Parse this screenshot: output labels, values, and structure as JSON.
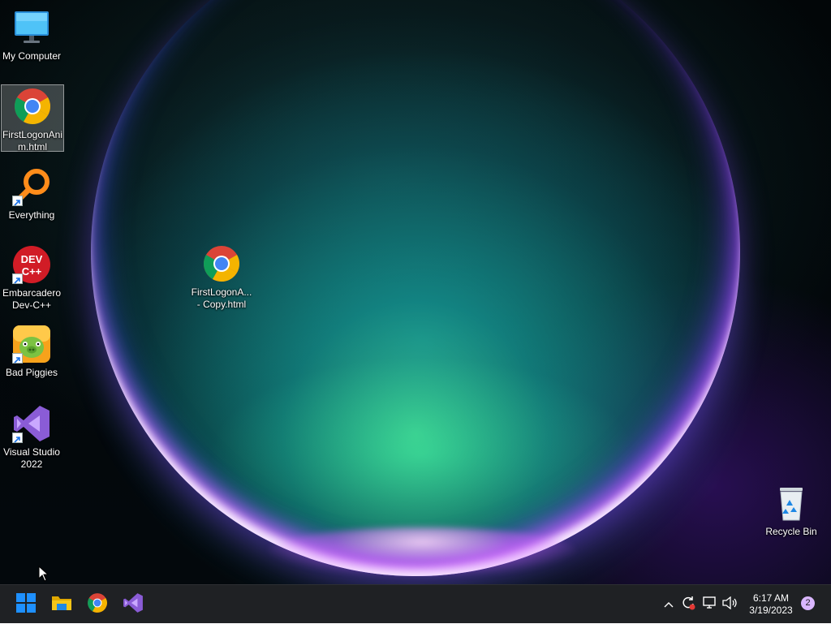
{
  "desktop": {
    "icons": [
      {
        "label": "My Computer",
        "icon": "computer-icon"
      },
      {
        "label": "FirstLogonAnim.html",
        "icon": "chrome-icon",
        "selected": true
      },
      {
        "label": "Everything",
        "icon": "everything-search-icon",
        "shortcut": true
      },
      {
        "label": "Embarcadero Dev-C++",
        "icon": "devcpp-icon",
        "shortcut": true
      },
      {
        "label": "Bad Piggies",
        "icon": "bad-piggies-icon",
        "shortcut": true
      },
      {
        "label": "Visual Studio 2022",
        "icon": "visual-studio-icon",
        "shortcut": true
      },
      {
        "label": "FirstLogonA... - Copy.html",
        "icon": "chrome-icon"
      },
      {
        "label": "Recycle Bin",
        "icon": "recycle-bin-icon"
      }
    ]
  },
  "taskbar": {
    "apps": [
      {
        "name": "Start",
        "icon": "windows-start-icon"
      },
      {
        "name": "File Explorer",
        "icon": "folder-icon"
      },
      {
        "name": "Google Chrome",
        "icon": "chrome-icon"
      },
      {
        "name": "Visual Studio",
        "icon": "visual-studio-icon"
      }
    ],
    "tray": {
      "icons": [
        "chevron-up-icon",
        "sync-icon",
        "network-icon",
        "volume-icon"
      ],
      "time": "6:17 AM",
      "date": "3/19/2023",
      "notification_count": "2"
    }
  },
  "colors": {
    "taskbar_bg": "#1f2124",
    "windows_blue": "#1e90ff",
    "vs_purple": "#8a5cd6",
    "folder_yellow": "#f5c518"
  }
}
